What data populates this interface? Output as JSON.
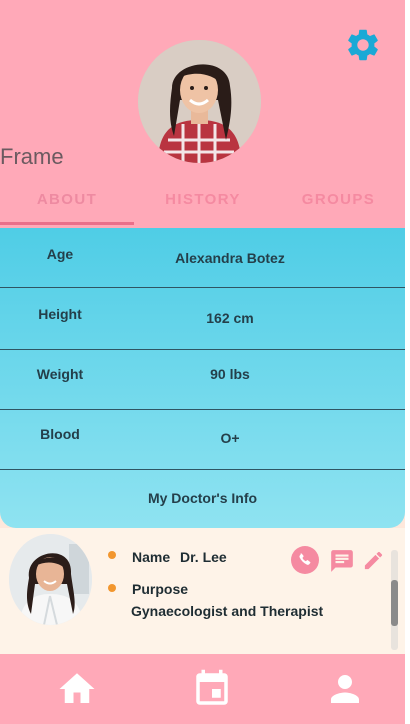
{
  "header": {
    "frame_label": "Frame",
    "settings_icon": "gear-icon",
    "accent": "#1aa9d6",
    "background": "#ffa9b8"
  },
  "tabs": [
    {
      "label": "ABOUT",
      "active": true
    },
    {
      "label": "HISTORY",
      "active": false
    },
    {
      "label": "GROUPS",
      "active": false
    }
  ],
  "profile": {
    "rows": [
      {
        "label": "Age",
        "value": "Alexandra Botez"
      },
      {
        "label": "Height",
        "value": "162 cm"
      },
      {
        "label": "Weight",
        "value": "90 lbs"
      },
      {
        "label": "Blood",
        "value": "O+"
      }
    ],
    "doctor_section_title": "My Doctor's Info"
  },
  "doctor": {
    "name_label": "Name",
    "name_value": "Dr. Lee",
    "purpose_label": "Purpose",
    "purpose_value": "Gynaecologist and Therapist",
    "actions": [
      "phone-icon",
      "message-icon",
      "edit-icon"
    ],
    "action_color": "#f58aa1",
    "bullet_color": "#f2962e"
  },
  "bottom_nav": {
    "items": [
      "home-icon",
      "calendar-icon",
      "person-icon"
    ],
    "icon_color": "#ffffff"
  }
}
